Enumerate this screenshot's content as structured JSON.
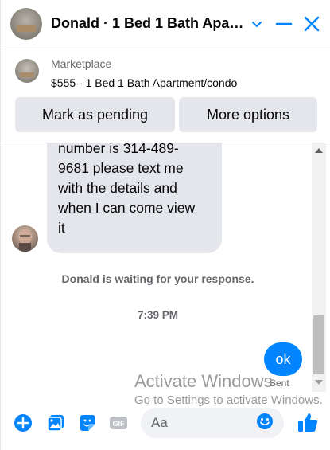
{
  "header": {
    "title": "Donald · 1 Bed 1 Bath Apar...",
    "icons": [
      "chevron-down-icon",
      "minimize-icon",
      "close-icon"
    ]
  },
  "marketplace": {
    "label": "Marketplace",
    "item": "$555 - 1 Bed 1 Bath Apartment/condo",
    "buttons": {
      "pending": "Mark as pending",
      "more": "More options"
    }
  },
  "conversation": {
    "message_lines": [
      "number is 314-489-",
      "9681 please text me",
      "with the details and",
      "when I can come view",
      "it"
    ],
    "waiting": "Donald is waiting for your response.",
    "timestamp": "7:39 PM",
    "reply": "ok",
    "status": "Sent"
  },
  "composer": {
    "placeholder": "Aa",
    "icons": [
      "plus-icon",
      "image-icon",
      "sticker-icon",
      "gif-icon",
      "emoji-icon",
      "like-icon"
    ]
  },
  "watermark": {
    "title": "Activate Windows",
    "subtitle": "Go to Settings to activate Windows."
  },
  "colors": {
    "accent": "#0084ff",
    "bubble_gray": "#e4e6eb",
    "secondary_text": "#65676b"
  }
}
